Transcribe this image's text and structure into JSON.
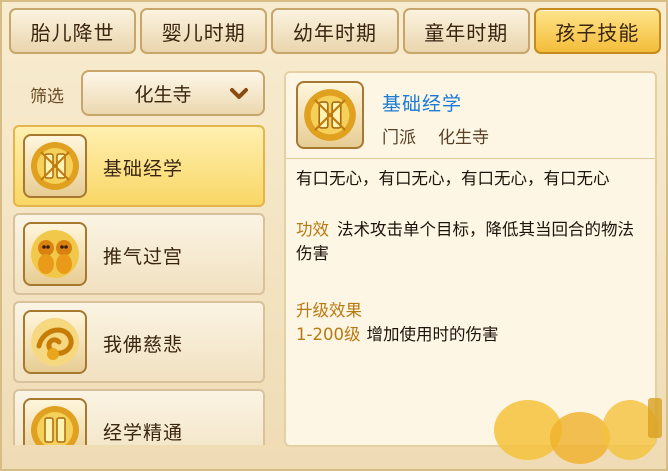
{
  "tabs": [
    {
      "label": "胎儿降世",
      "active": false
    },
    {
      "label": "婴儿时期",
      "active": false
    },
    {
      "label": "幼年时期",
      "active": false
    },
    {
      "label": "童年时期",
      "active": false
    },
    {
      "label": "孩子技能",
      "active": true
    }
  ],
  "filter": {
    "label": "筛选",
    "value": "化生寺"
  },
  "skills": [
    {
      "name": "基础经学",
      "icon": "scripture-icon",
      "selected": true
    },
    {
      "name": "推气过宫",
      "icon": "twin-dolls-icon",
      "selected": false
    },
    {
      "name": "我佛慈悲",
      "icon": "golden-swirl-icon",
      "selected": false
    },
    {
      "name": "经学精通",
      "icon": "scripture-icon",
      "selected": false
    }
  ],
  "detail": {
    "title": "基础经学",
    "school_label": "门派",
    "school": "化生寺",
    "description": "有口无心，有口无心，有口无心，有口无心",
    "effect_label": "功效",
    "effect": "法术攻击单个目标，降低其当回合的物法伤害",
    "upgrade_title": "升级效果",
    "upgrade_range": "1-200级",
    "upgrade_text": "增加使用时的伤害"
  },
  "colors": {
    "accent_blue": "#1a7ad6",
    "gold": "#b87a12",
    "active_tab": "#f3bd3a"
  }
}
